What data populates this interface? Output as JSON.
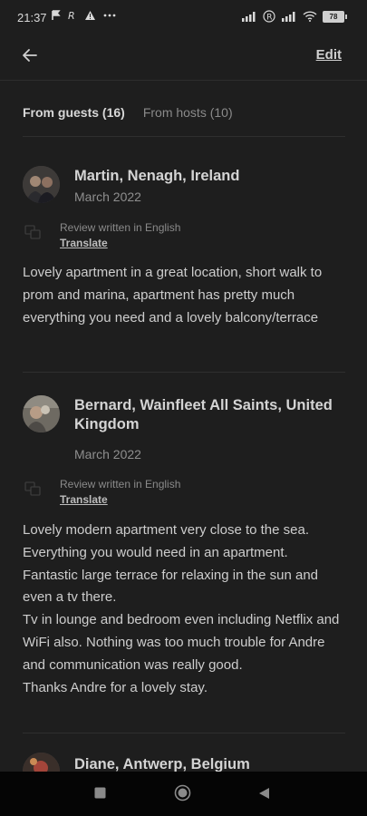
{
  "status_bar": {
    "time": "21:37",
    "left_icons": [
      "flag-icon",
      "registered-r-icon",
      "warning-icon",
      "more-dots-icon"
    ],
    "right_icons": [
      "signal-icon",
      "registered-r-icon",
      "signal-icon",
      "wifi-icon",
      "battery-icon"
    ],
    "battery": "78"
  },
  "header": {
    "edit_label": "Edit"
  },
  "tabs": [
    {
      "label": "From guests (16)",
      "active": true
    },
    {
      "label": "From hosts (10)",
      "active": false
    }
  ],
  "reviews": [
    {
      "name": "Martin, Nenagh, Ireland",
      "date": "March 2022",
      "lang_note": "Review written in English",
      "translate": "Translate",
      "text": "Lovely apartment in a great location, short walk to prom and marina, apartment has pretty much everything you need and a lovely balcony/terrace"
    },
    {
      "name": "Bernard, Wainfleet All Saints, United Kingdom",
      "date": "March 2022",
      "lang_note": "Review written in English",
      "translate": "Translate",
      "text": "Lovely modern apartment very close to the sea. Everything you would need in an apartment. Fantastic large terrace for relaxing in the sun and even a tv there.\nTv in lounge and bedroom even including Netflix and WiFi also. Nothing was too much trouble for Andre and communication was really good.\nThanks Andre for a lovely stay."
    },
    {
      "name": "Diane, Antwerp, Belgium"
    }
  ],
  "nav_bar": {
    "buttons": [
      "recents-button",
      "home-button",
      "back-button"
    ]
  }
}
